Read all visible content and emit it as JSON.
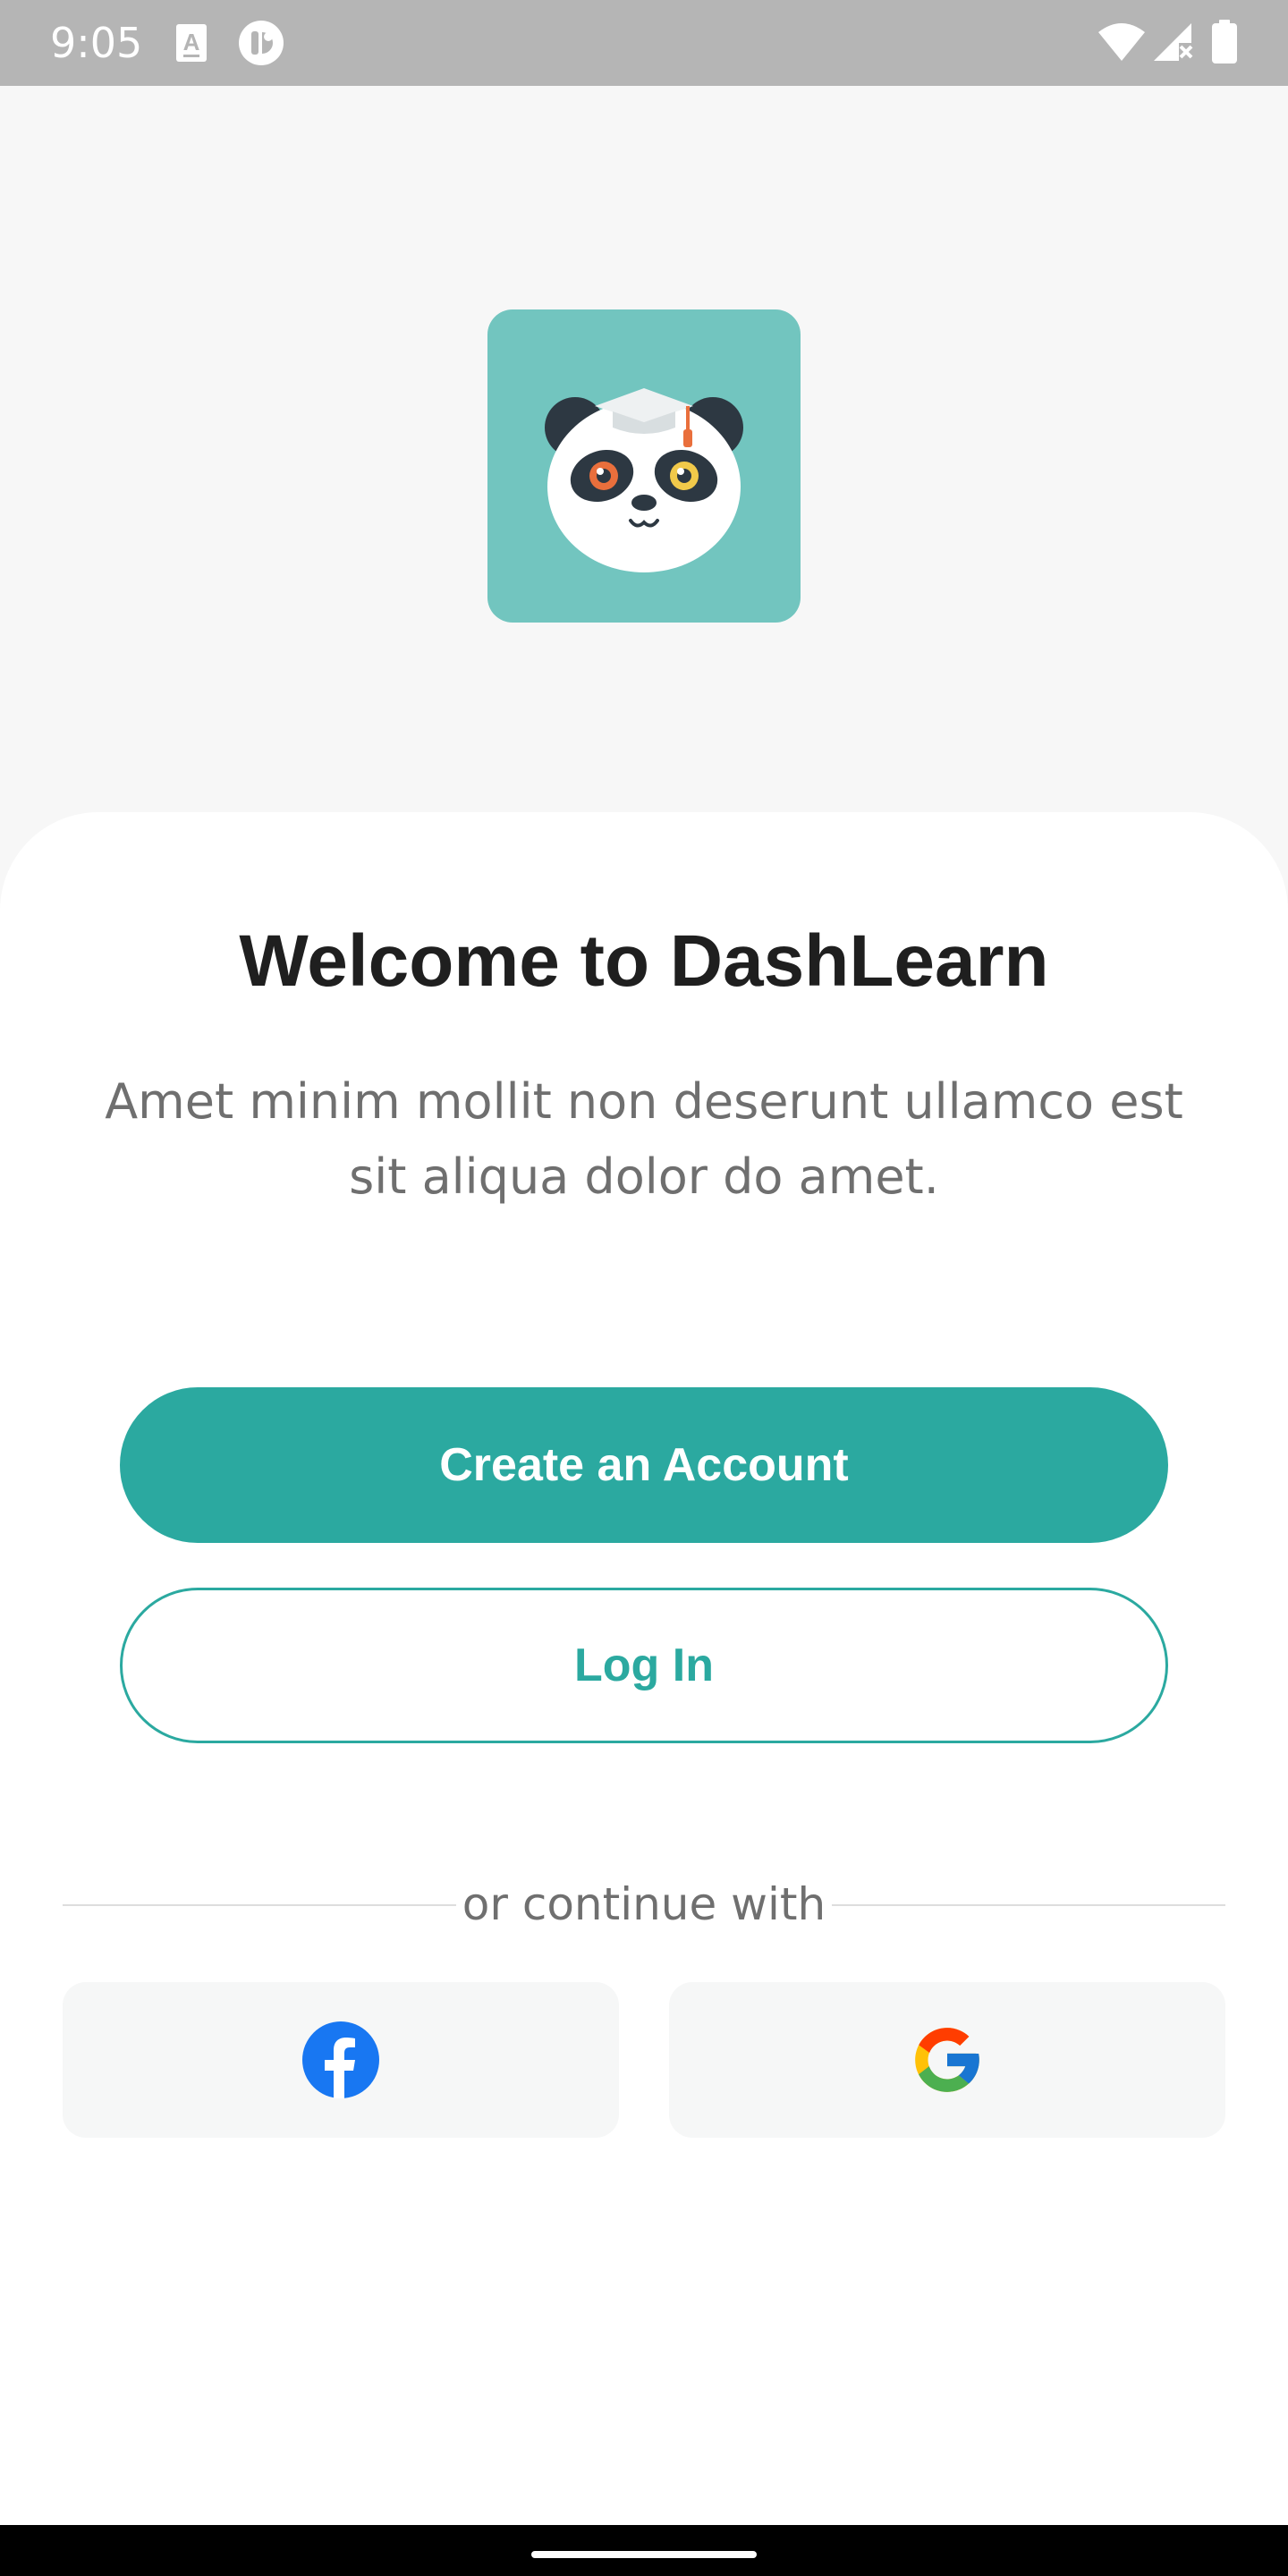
{
  "status_bar": {
    "time": "9:05",
    "left_icons": [
      "text-a-icon",
      "app-notification-icon"
    ],
    "right_icons": [
      "wifi-icon",
      "cell-signal-off-icon",
      "battery-icon"
    ]
  },
  "logo": {
    "icon": "panda-graduate-icon",
    "background": "#72c5bf"
  },
  "welcome": {
    "title": "Welcome to DashLearn",
    "subtitle": "Amet minim mollit non deserunt ullamco est sit aliqua dolor do amet."
  },
  "actions": {
    "create_account_label": "Create an Account",
    "login_label": "Log In",
    "accent_color": "#2ba9a0"
  },
  "social": {
    "divider_label": "or continue with",
    "providers": [
      {
        "name": "facebook",
        "icon": "facebook-icon"
      },
      {
        "name": "google",
        "icon": "google-icon"
      }
    ]
  }
}
